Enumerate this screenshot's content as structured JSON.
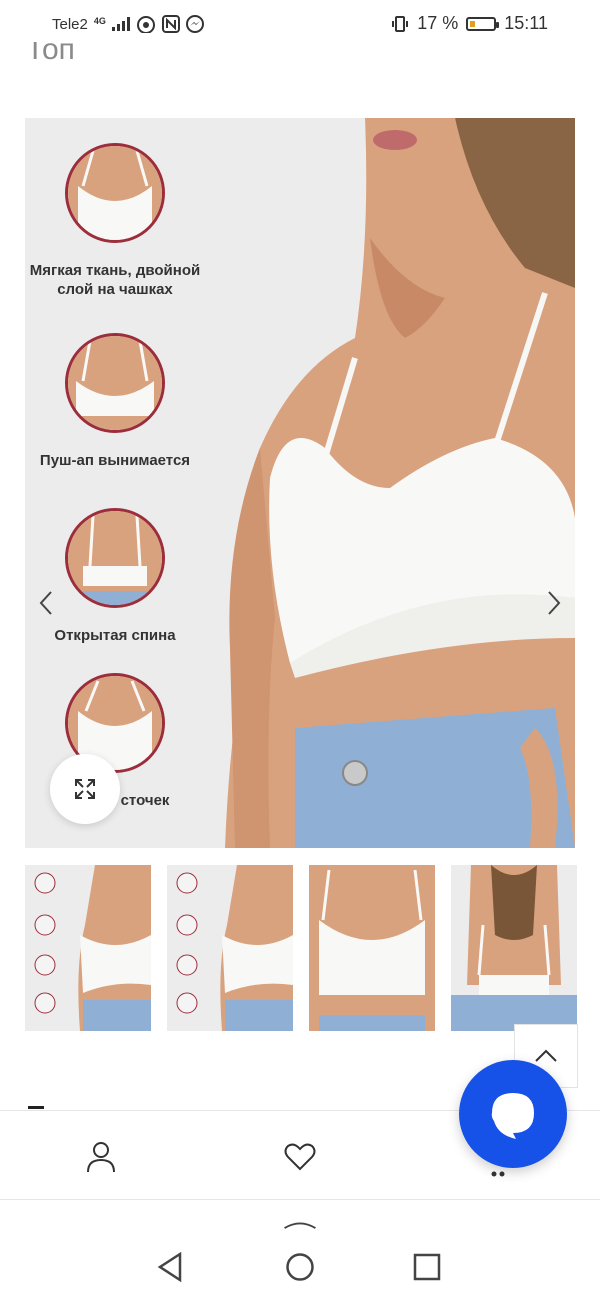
{
  "status_bar": {
    "carrier": "Tele2",
    "network": "4G",
    "battery_percent": "17 %",
    "time": "15:11",
    "icons": [
      "signal-icon",
      "wifi-icon",
      "nfc-icon",
      "messenger-icon",
      "vibrate-icon",
      "battery-icon"
    ]
  },
  "page": {
    "title_partial": "Топ"
  },
  "gallery": {
    "features": [
      {
        "caption": "Мягкая ткань, двойной слой на чашках"
      },
      {
        "caption": "Пуш-ап вынимается"
      },
      {
        "caption": "Открытая спина"
      },
      {
        "caption": "сточек"
      }
    ],
    "thumbnails": [
      {
        "name": "thumb-1"
      },
      {
        "name": "thumb-2"
      },
      {
        "name": "thumb-3"
      },
      {
        "name": "thumb-4"
      }
    ],
    "icons": [
      "chevron-left-icon",
      "chevron-right-icon",
      "expand-icon"
    ]
  },
  "bottom_nav": {
    "icons": [
      "user-icon",
      "heart-icon",
      "cart-icon",
      "chat-icon",
      "chevron-up-icon"
    ]
  },
  "system_nav": {
    "icons": [
      "back-icon",
      "home-icon",
      "recents-icon",
      "swipe-up-icon"
    ]
  },
  "colors": {
    "accent": "#1652e8",
    "circle_border": "#9c2d3c",
    "image_bg": "#ececec"
  }
}
